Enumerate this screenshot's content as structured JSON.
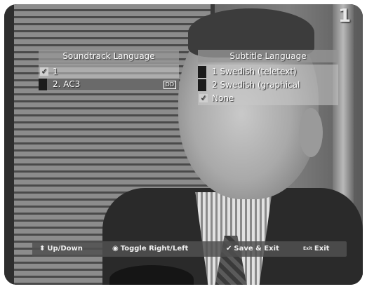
{
  "channel_number": "1",
  "soundtrack_panel": {
    "title": "Soundtrack Language",
    "items": [
      {
        "label": "1",
        "checked": true,
        "tag": ""
      },
      {
        "label": "2. AC3",
        "checked": false,
        "tag": "DD",
        "selected": true
      }
    ]
  },
  "subtitle_panel": {
    "title": "Subtitle Language",
    "items": [
      {
        "label": "1 Swedish (teletext)",
        "checked": false
      },
      {
        "label": "2 Swedish (graphical",
        "checked": false
      },
      {
        "label": "None",
        "checked": true
      }
    ]
  },
  "help_bar": {
    "up_down": "Up/Down",
    "toggle": "Toggle Right/Left",
    "save_exit": "Save & Exit",
    "exit": "Exit",
    "exit_key": "Exit"
  },
  "icons": {
    "up_down": "up-down-arrows-icon",
    "toggle": "circle-icon",
    "save": "checkmark-icon",
    "exit": "exit-key-icon"
  }
}
